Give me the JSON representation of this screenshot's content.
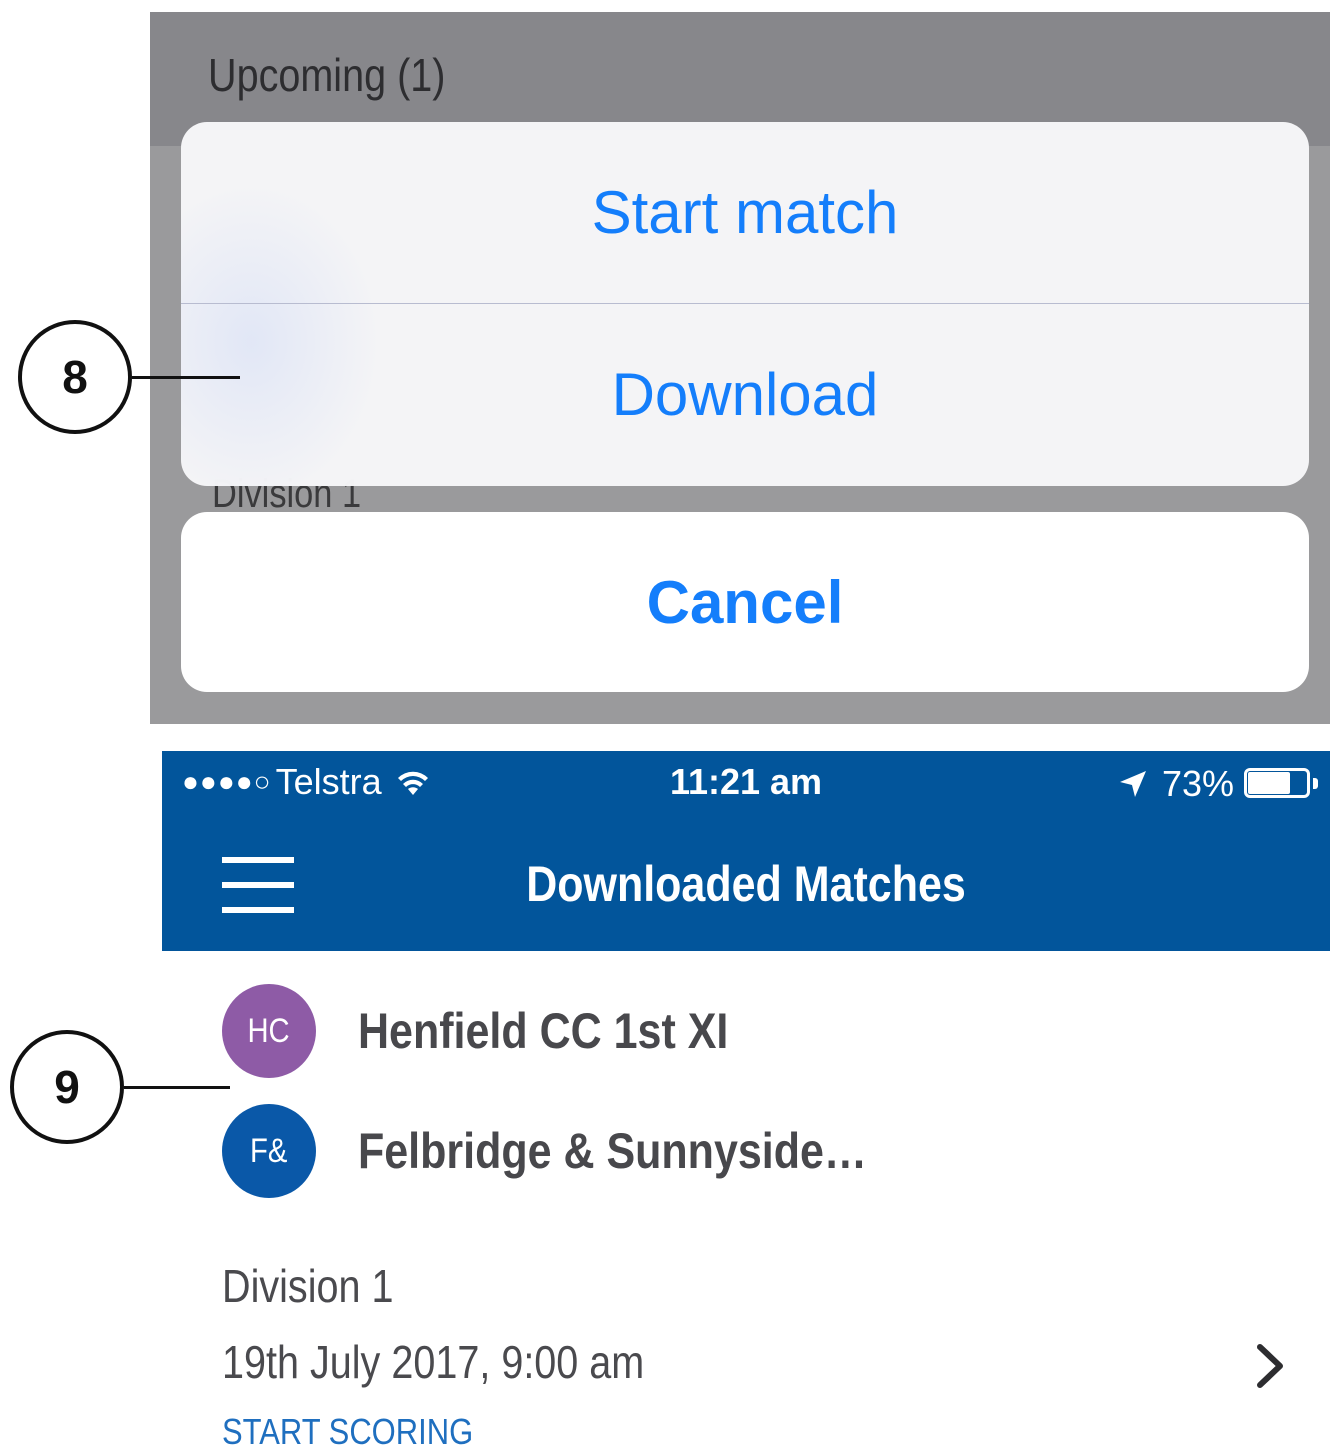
{
  "action_sheet": {
    "section_title": "Upcoming (1)",
    "peek_text": "Division 1",
    "actions": [
      {
        "label": "Start match"
      },
      {
        "label": "Download"
      }
    ],
    "cancel_label": "Cancel"
  },
  "callouts": {
    "first": "8",
    "second": "9"
  },
  "status_bar": {
    "signal": "●●●●○",
    "carrier": "Telstra",
    "time": "11:21 am",
    "battery_percent": "73%",
    "battery_level": 0.73
  },
  "nav": {
    "title": "Downloaded Matches"
  },
  "match": {
    "teams": [
      {
        "initials": "HC",
        "name": "Henfield CC 1st XI",
        "color": "#8e5ba6"
      },
      {
        "initials": "F&",
        "name": "Felbridge & Sunnyside…",
        "color": "#0a58a8"
      }
    ],
    "division": "Division 1",
    "datetime": "19th July 2017, 9:00 am",
    "action_label": "START SCORING"
  },
  "colors": {
    "accent_blue": "#147efb",
    "header_blue": "#02559b",
    "link_blue": "#1f6fbf"
  }
}
